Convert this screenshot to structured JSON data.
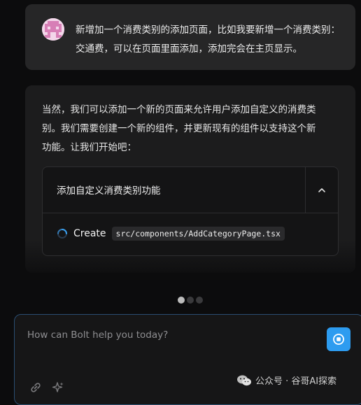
{
  "conversation": {
    "user_message": "新增加一个消费类别的添加页面，比如我要新增一个消费类别：交通费，可以在页面里面添加，添加完会在主页显示。",
    "assistant_message": "当然，我们可以添加一个新的页面来允许用户添加自定义的消费类别。我们需要创建一个新的组件，并更新现有的组件以支持这个新功能。让我们开始吧：",
    "artifact": {
      "title": "添加自定义消费类别功能",
      "collapse_icon": "chevron-up-icon",
      "action": {
        "verb": "Create",
        "file": "src/components/AddCategoryPage.tsx",
        "status_icon": "spinner-icon"
      }
    }
  },
  "pagination": {
    "count": 3,
    "active": 0
  },
  "composer": {
    "placeholder": "How can Bolt help you today?",
    "stop_icon": "stop-icon",
    "attach_icon": "link-icon",
    "enhance_icon": "sparkle-icon"
  },
  "watermark": {
    "text": "公众号 · 谷哥AI探索"
  },
  "colors": {
    "accent": "#2d9cf0",
    "background": "#0c0c0d",
    "card": "#262627"
  }
}
